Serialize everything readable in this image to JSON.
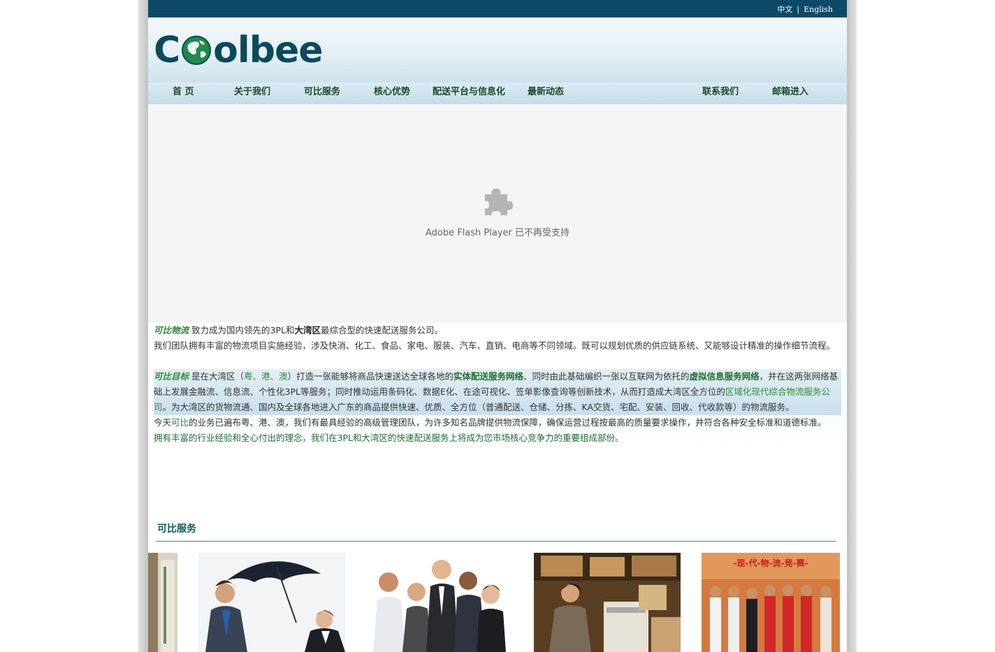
{
  "topbar": {
    "lang_cn": "中文",
    "lang_sep": "|",
    "lang_en": "English"
  },
  "logo": {
    "text_c": "C",
    "text_rest": "olbee",
    "brand_color": "#0c4a5a",
    "globe_color": "#1f8a4c"
  },
  "nav": {
    "items": [
      {
        "label": "首 页"
      },
      {
        "label": "关于我们"
      },
      {
        "label": "可比服务"
      },
      {
        "label": "核心优势"
      },
      {
        "label": "配送平台与信息化"
      },
      {
        "label": "最新动态"
      },
      {
        "label": "联系我们"
      },
      {
        "label": "邮箱进入"
      }
    ]
  },
  "flash": {
    "icon": "puzzle-icon",
    "message": "Adobe Flash Player 已不再受支持"
  },
  "intro": {
    "p1": {
      "brand": "可比物流",
      "t1": " 致力成为国内领先的3PL和",
      "strong": "大湾区",
      "t2": "最综合型的快速配送服务公司。"
    },
    "p2": "我们团队拥有丰富的物流项目实施经验，涉及快消、化工、食品、家电、服装、汽车、直销、电商等不同领域。既可以规划优质的供应链系统、又能够设计精准的操作细节流程。",
    "p3": {
      "brand": "可比目标",
      "t1": " 是在大湾区（",
      "regions": "粤、港、澳",
      "t2": "）打造一张能够将商品快速送达全球各地的",
      "net1": "实体配送服务网络",
      "t3": "、同时由此基础编织一张以互联网为依托的",
      "net2": "虚拟信息服务网络",
      "t4": "，并在这两张网络基础上发展金融流、信息流、个性化3PL等服务；同时推动运用条码化、数据E化、在途可视化、签单影像查询等创新技术，从而打造成大湾区全方位的",
      "region_co": "区域化现代综合物流服务公司",
      "t5": "。为大湾区的货物流通、国内及全球各地进入广东的商品提供快速、优质、全方位（普通配送、仓储、分拣、KA交货、宅配、安装、回收、代收款等）的物流服务。"
    },
    "p4": {
      "t1": "今天",
      "brand": "可比",
      "t2": "的业务已遍布粤、港、澳，我们有最具经验的高级管理团队，为许多知名品牌提供物流保障，确保运营过程按最高的质量要求操作，并符合各种安全标准和道德标准。"
    },
    "p5": "拥有丰富的行业经验和全心付出的理念，我们在3PL和大湾区的快速配送服务上将成为您市场核心竞争力的重要组成部份。"
  },
  "services": {
    "title": "可比服务",
    "banner_text": "-现-代-物-流-竞-赛-"
  }
}
